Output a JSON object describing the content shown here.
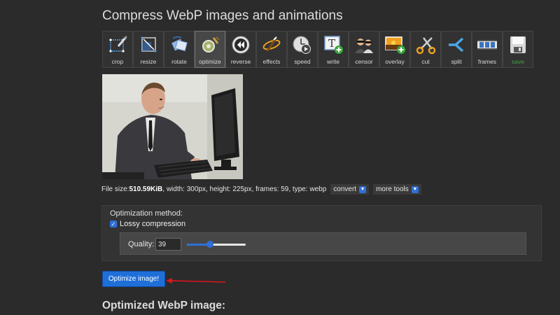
{
  "page": {
    "title": "Compress WebP images and animations"
  },
  "toolbar": {
    "items": [
      {
        "label": "crop",
        "icon": "crop-icon"
      },
      {
        "label": "resize",
        "icon": "resize-icon"
      },
      {
        "label": "rotate",
        "icon": "rotate-icon"
      },
      {
        "label": "optimize",
        "icon": "optimize-icon",
        "active": true
      },
      {
        "label": "reverse",
        "icon": "reverse-icon"
      },
      {
        "label": "effects",
        "icon": "effects-icon"
      },
      {
        "label": "speed",
        "icon": "speed-icon"
      },
      {
        "label": "write",
        "icon": "write-icon"
      },
      {
        "label": "censor",
        "icon": "censor-icon"
      },
      {
        "label": "overlay",
        "icon": "overlay-icon"
      },
      {
        "label": "cut",
        "icon": "cut-icon"
      },
      {
        "label": "split",
        "icon": "split-icon"
      },
      {
        "label": "frames",
        "icon": "frames-icon"
      },
      {
        "label": "save",
        "icon": "save-icon"
      }
    ]
  },
  "fileinfo": {
    "prefix": "File size: ",
    "size": "510.59KiB",
    "details": ", width: 300px, height: 225px, frames: 59, type: webp",
    "convert_label": "convert",
    "more_tools_label": "more tools"
  },
  "optimization": {
    "method_label": "Optimization method:",
    "lossy_label": "Lossy compression",
    "lossy_checked": true,
    "quality_label": "Quality:",
    "quality_value": "39",
    "quality_fraction": 0.39
  },
  "actions": {
    "optimize_label": "Optimize image!"
  },
  "result": {
    "title": "Optimized WebP image:"
  },
  "colors": {
    "accent": "#1f6fd9",
    "arrow": "#e0141e",
    "background": "#2b2b2b"
  }
}
